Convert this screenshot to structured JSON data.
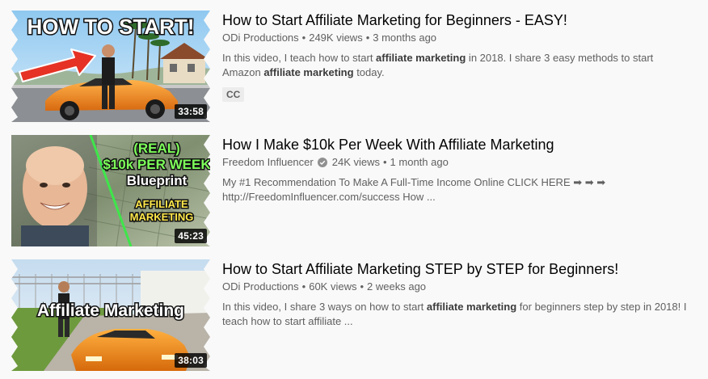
{
  "results": [
    {
      "thumbnail": {
        "overlay_text": "HOW TO START!",
        "duration": "33:58"
      },
      "title": "How to Start Affiliate Marketing for Beginners - EASY!",
      "channel": "ODi Productions",
      "views": "249K views",
      "age": "3 months ago",
      "description": {
        "part1": "In this video, I teach how to start ",
        "bold1": "affiliate marketing",
        "part2": " in 2018. I share 3 easy methods to start Amazon ",
        "bold2": "affiliate marketing",
        "part3": " today."
      },
      "badge": "CC"
    },
    {
      "thumbnail": {
        "overlay_line1": "(REAL)",
        "overlay_line2": "$10k PER WEEK",
        "overlay_line3": "Blueprint",
        "overlay_line4": "AFFILIATE",
        "overlay_line5": "MARKETING",
        "duration": "45:23"
      },
      "title": "How I Make $10k Per Week With Affiliate Marketing",
      "channel": "Freedom Influencer",
      "views": "24K views",
      "age": "1 month ago",
      "description": {
        "line1": "My #1 Recommendation To Make A Full-Time Income Online CLICK HERE ➡ ➡ ➡",
        "line2": "http://FreedomInfluencer.com/success How ..."
      }
    },
    {
      "thumbnail": {
        "overlay_text": "Affiliate Marketing",
        "duration": "38:03"
      },
      "title": "How to Start Affiliate Marketing STEP by STEP for Beginners!",
      "channel": "ODi Productions",
      "views": "60K views",
      "age": "2 weeks ago",
      "description": {
        "part1": "In this video, I share 3 ways on how to start ",
        "bold1": "affiliate marketing",
        "part2": " for beginners step by step in 2018! I teach how to start affiliate ..."
      }
    }
  ],
  "colors": {
    "title": "#030303",
    "meta": "#606060",
    "background": "#f9f9f9",
    "car": "#f08a1c",
    "green_line": "#3ee64a",
    "arrow": "#e53224"
  }
}
